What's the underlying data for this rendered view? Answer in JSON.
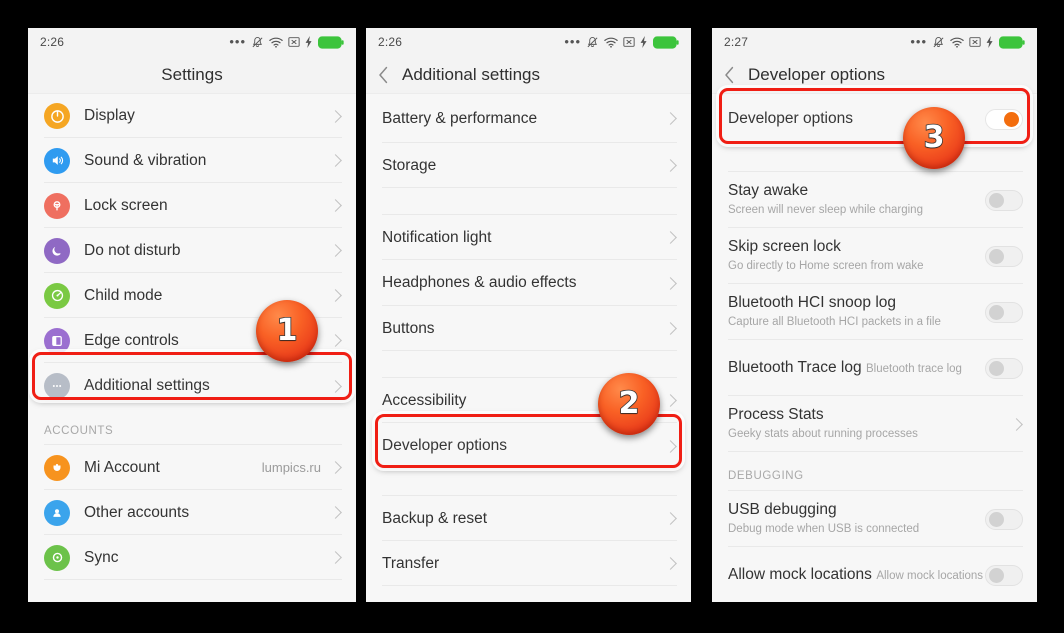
{
  "colors": {
    "background": "#000000",
    "panel_bg": "#f7f7f7",
    "header_bg": "#f3f3f3",
    "highlight_red": "#f01e14",
    "badge_orange": "#f96125",
    "toggle_on": "#f36b0a",
    "battery_green": "#3cc43c"
  },
  "panel1": {
    "statusbar": {
      "clock": "2:26",
      "icons": [
        "more-dots-icon",
        "bell-muted-icon",
        "wifi-icon",
        "no-sim-icon",
        "charging-bolt-icon",
        "battery-icon"
      ]
    },
    "title": "Settings",
    "rows": [
      {
        "label": "Display",
        "icon": "display-icon",
        "icon_color": "#f5a623",
        "chevron": true
      },
      {
        "label": "Sound & vibration",
        "icon": "sound-icon",
        "icon_color": "#2f9bf0",
        "chevron": true
      },
      {
        "label": "Lock screen",
        "icon": "lock-screen-icon",
        "icon_color": "#ef6f60",
        "chevron": true
      },
      {
        "label": "Do not disturb",
        "icon": "moon-icon",
        "icon_color": "#8f69c4",
        "chevron": true
      },
      {
        "label": "Child mode",
        "icon": "child-mode-icon",
        "icon_color": "#7ac943",
        "chevron": true
      },
      {
        "label": "Edge controls",
        "icon": "edge-controls-icon",
        "icon_color": "#9b6fd0",
        "chevron": true
      },
      {
        "label": "Additional settings",
        "icon": "more-dots-circle-icon",
        "icon_color": "#b6bcc6",
        "chevron": true,
        "highlighted": true
      }
    ],
    "section_header": "ACCOUNTS",
    "account_rows": [
      {
        "label": "Mi Account",
        "icon": "mi-account-icon",
        "icon_color": "#f7931e",
        "value": "lumpics.ru",
        "chevron": true
      },
      {
        "label": "Other accounts",
        "icon": "other-accounts-icon",
        "icon_color": "#3ba4ec",
        "value": "",
        "chevron": true
      },
      {
        "label": "Sync",
        "icon": "sync-icon",
        "icon_color": "#6cc24a",
        "value": "",
        "chevron": true
      }
    ],
    "badge": "1"
  },
  "panel2": {
    "statusbar": {
      "clock": "2:26",
      "icons": [
        "more-dots-icon",
        "bell-muted-icon",
        "wifi-icon",
        "no-sim-icon",
        "charging-bolt-icon",
        "battery-icon"
      ]
    },
    "title": "Additional settings",
    "back_icon": "back-chevron-icon",
    "rows": [
      {
        "label": "Battery & performance",
        "chevron": true
      },
      {
        "label": "Storage",
        "chevron": true
      },
      {
        "label": "__GAP__"
      },
      {
        "label": "Notification light",
        "chevron": true
      },
      {
        "label": "Headphones & audio effects",
        "chevron": true
      },
      {
        "label": "Buttons",
        "chevron": true
      },
      {
        "label": "__GAP__"
      },
      {
        "label": "Accessibility",
        "chevron": true
      },
      {
        "label": "Developer options",
        "chevron": true,
        "highlighted": true
      },
      {
        "label": "__GAP__"
      },
      {
        "label": "Backup & reset",
        "chevron": true
      },
      {
        "label": "Transfer",
        "chevron": true
      }
    ],
    "badge": "2"
  },
  "panel3": {
    "statusbar": {
      "clock": "2:27",
      "icons": [
        "more-dots-icon",
        "bell-muted-icon",
        "wifi-icon",
        "no-sim-icon",
        "charging-bolt-icon",
        "battery-icon"
      ]
    },
    "title": "Developer options",
    "back_icon": "back-chevron-icon",
    "rows": [
      {
        "label": "Developer options",
        "sub": "",
        "control": "toggle-on",
        "highlighted": true
      },
      {
        "label": "Stay awake",
        "sub": "Screen will never sleep while charging",
        "control": "toggle-off"
      },
      {
        "label": "Skip screen lock",
        "sub": "Go directly to Home screen from wake",
        "control": "toggle-off"
      },
      {
        "label": "Bluetooth HCI snoop log",
        "sub": "Capture all Bluetooth HCI packets in a file",
        "control": "toggle-off"
      },
      {
        "label": "Bluetooth Trace log",
        "sub": "Bluetooth trace log",
        "control": "toggle-off"
      },
      {
        "label": "Process Stats",
        "sub": "Geeky stats about running processes",
        "control": "chevron"
      }
    ],
    "section_header": "DEBUGGING",
    "debug_rows": [
      {
        "label": "USB debugging",
        "sub": "Debug mode when USB is connected",
        "control": "toggle-off"
      },
      {
        "label": "Allow mock locations",
        "sub": "Allow mock locations",
        "control": "toggle-off"
      }
    ],
    "badge": "3"
  }
}
